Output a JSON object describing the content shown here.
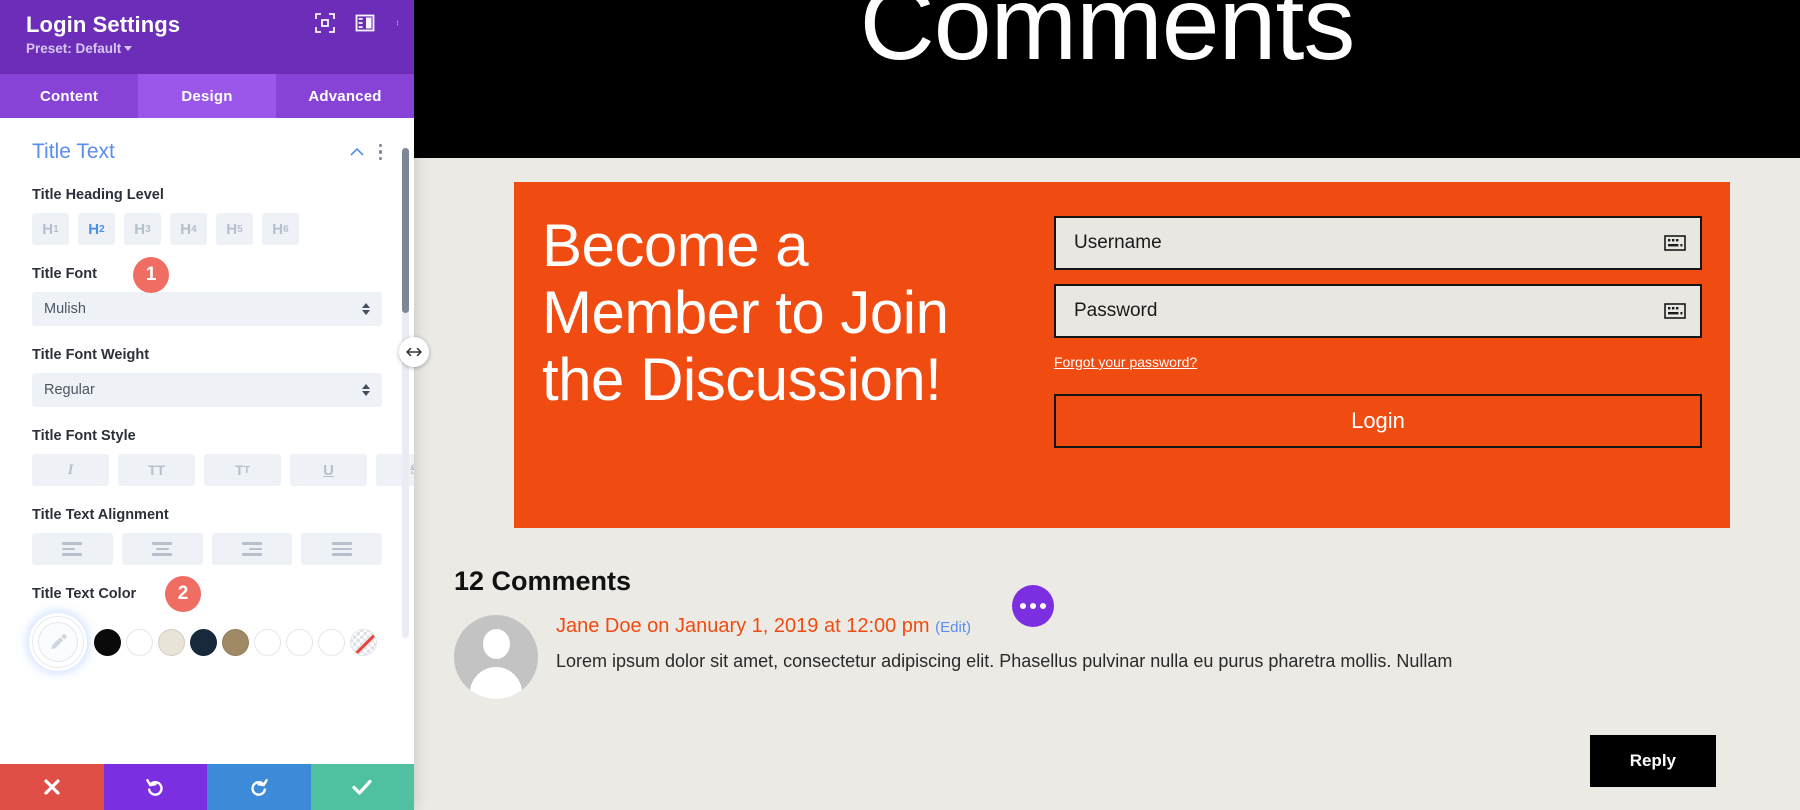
{
  "panel": {
    "title": "Login Settings",
    "preset": "Preset: Default",
    "header_icons": [
      {
        "name": "fullscreen-icon"
      },
      {
        "name": "layout-toggle-icon"
      },
      {
        "name": "more-options-icon"
      }
    ],
    "tabs": [
      {
        "label": "Content",
        "active": false
      },
      {
        "label": "Design",
        "active": true
      },
      {
        "label": "Advanced",
        "active": false
      }
    ],
    "section": {
      "title": "Title Text",
      "collapse_icon": "chevron-up-icon",
      "menu_icon": "vertical-dots-icon"
    },
    "fields": {
      "heading_level": {
        "label": "Title Heading Level",
        "options": [
          "H1",
          "H2",
          "H3",
          "H4",
          "H5",
          "H6"
        ],
        "selected": "H2"
      },
      "title_font": {
        "label": "Title Font",
        "value": "Mulish",
        "badge": "1"
      },
      "title_font_weight": {
        "label": "Title Font Weight",
        "value": "Regular"
      },
      "title_font_style": {
        "label": "Title Font Style",
        "options": [
          "I",
          "TT",
          "TT",
          "U",
          "S"
        ],
        "icon_names": [
          "italic-icon",
          "uppercase-icon",
          "smallcaps-icon",
          "underline-icon",
          "strikethrough-icon"
        ]
      },
      "title_text_alignment": {
        "label": "Title Text Alignment",
        "icon_names": [
          "align-left-icon",
          "align-center-icon",
          "align-right-icon",
          "align-justify-icon"
        ]
      },
      "title_text_color": {
        "label": "Title Text Color",
        "badge": "2",
        "eyedropper_icon": "eyedropper-icon",
        "swatches": [
          "#0a0a0a",
          "#ffffff",
          "#e9e4d8",
          "#17293b",
          "#a08a66",
          "",
          "",
          ""
        ],
        "no_color_icon": "no-color-icon"
      }
    },
    "footer": [
      {
        "name": "cancel-button",
        "icon": "close-icon",
        "color": "#e04f45"
      },
      {
        "name": "undo-button",
        "icon": "undo-icon",
        "color": "#7b2fe0"
      },
      {
        "name": "redo-button",
        "icon": "redo-icon",
        "color": "#3d8bd8"
      },
      {
        "name": "save-button",
        "icon": "check-icon",
        "color": "#4fc1a0"
      }
    ],
    "drag_handle_icon": "horizontal-resize-icon"
  },
  "canvas": {
    "hero_title": "Comments",
    "cta": {
      "heading": "Become a Member to Join the Discussion!",
      "username_placeholder": "Username",
      "password_placeholder": "Password",
      "forgot_link": "Forgot your password?",
      "login_button": "Login",
      "background_color": "#f04b11"
    },
    "comments": {
      "count_heading": "12 Comments",
      "items": [
        {
          "author": "Jane Doe",
          "meta": "Jane Doe on January 1, 2019 at 12:00 pm",
          "edit_label": "(Edit)",
          "text": "Lorem ipsum dolor sit amet, consectetur adipiscing elit. Phasellus pulvinar nulla eu purus pharetra mollis. Nullam",
          "reply_label": "Reply"
        }
      ],
      "options_icon": "horizontal-dots-icon"
    }
  }
}
